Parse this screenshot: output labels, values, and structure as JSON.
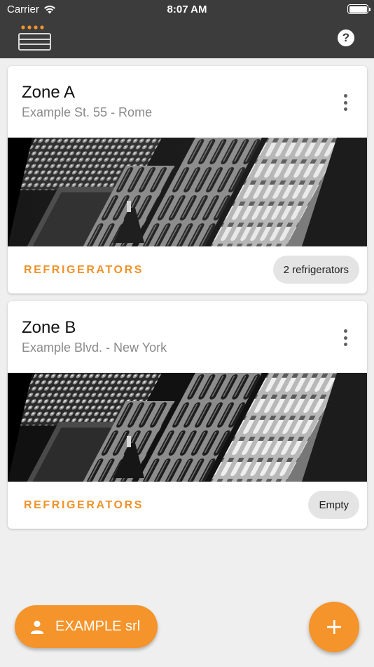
{
  "status_bar": {
    "carrier": "Carrier",
    "time": "8:07 AM"
  },
  "app_bar": {
    "logo_icon": "refrigerator-logo-icon",
    "help_icon": "help-circle-icon",
    "help_glyph": "?"
  },
  "zones": [
    {
      "name": "Zone A",
      "address": "Example St. 55 - Rome",
      "section_label": "REFRIGERATORS",
      "status_chip": "2 refrigerators"
    },
    {
      "name": "Zone B",
      "address": "Example Blvd. - New York",
      "section_label": "REFRIGERATORS",
      "status_chip": "Empty"
    }
  ],
  "footer": {
    "company_label": "EXAMPLE srl",
    "company_icon": "person-icon",
    "add_icon": "plus-icon"
  },
  "colors": {
    "accent": "#f4942b",
    "app_bar": "#3c3c3c",
    "background": "#efefef"
  }
}
